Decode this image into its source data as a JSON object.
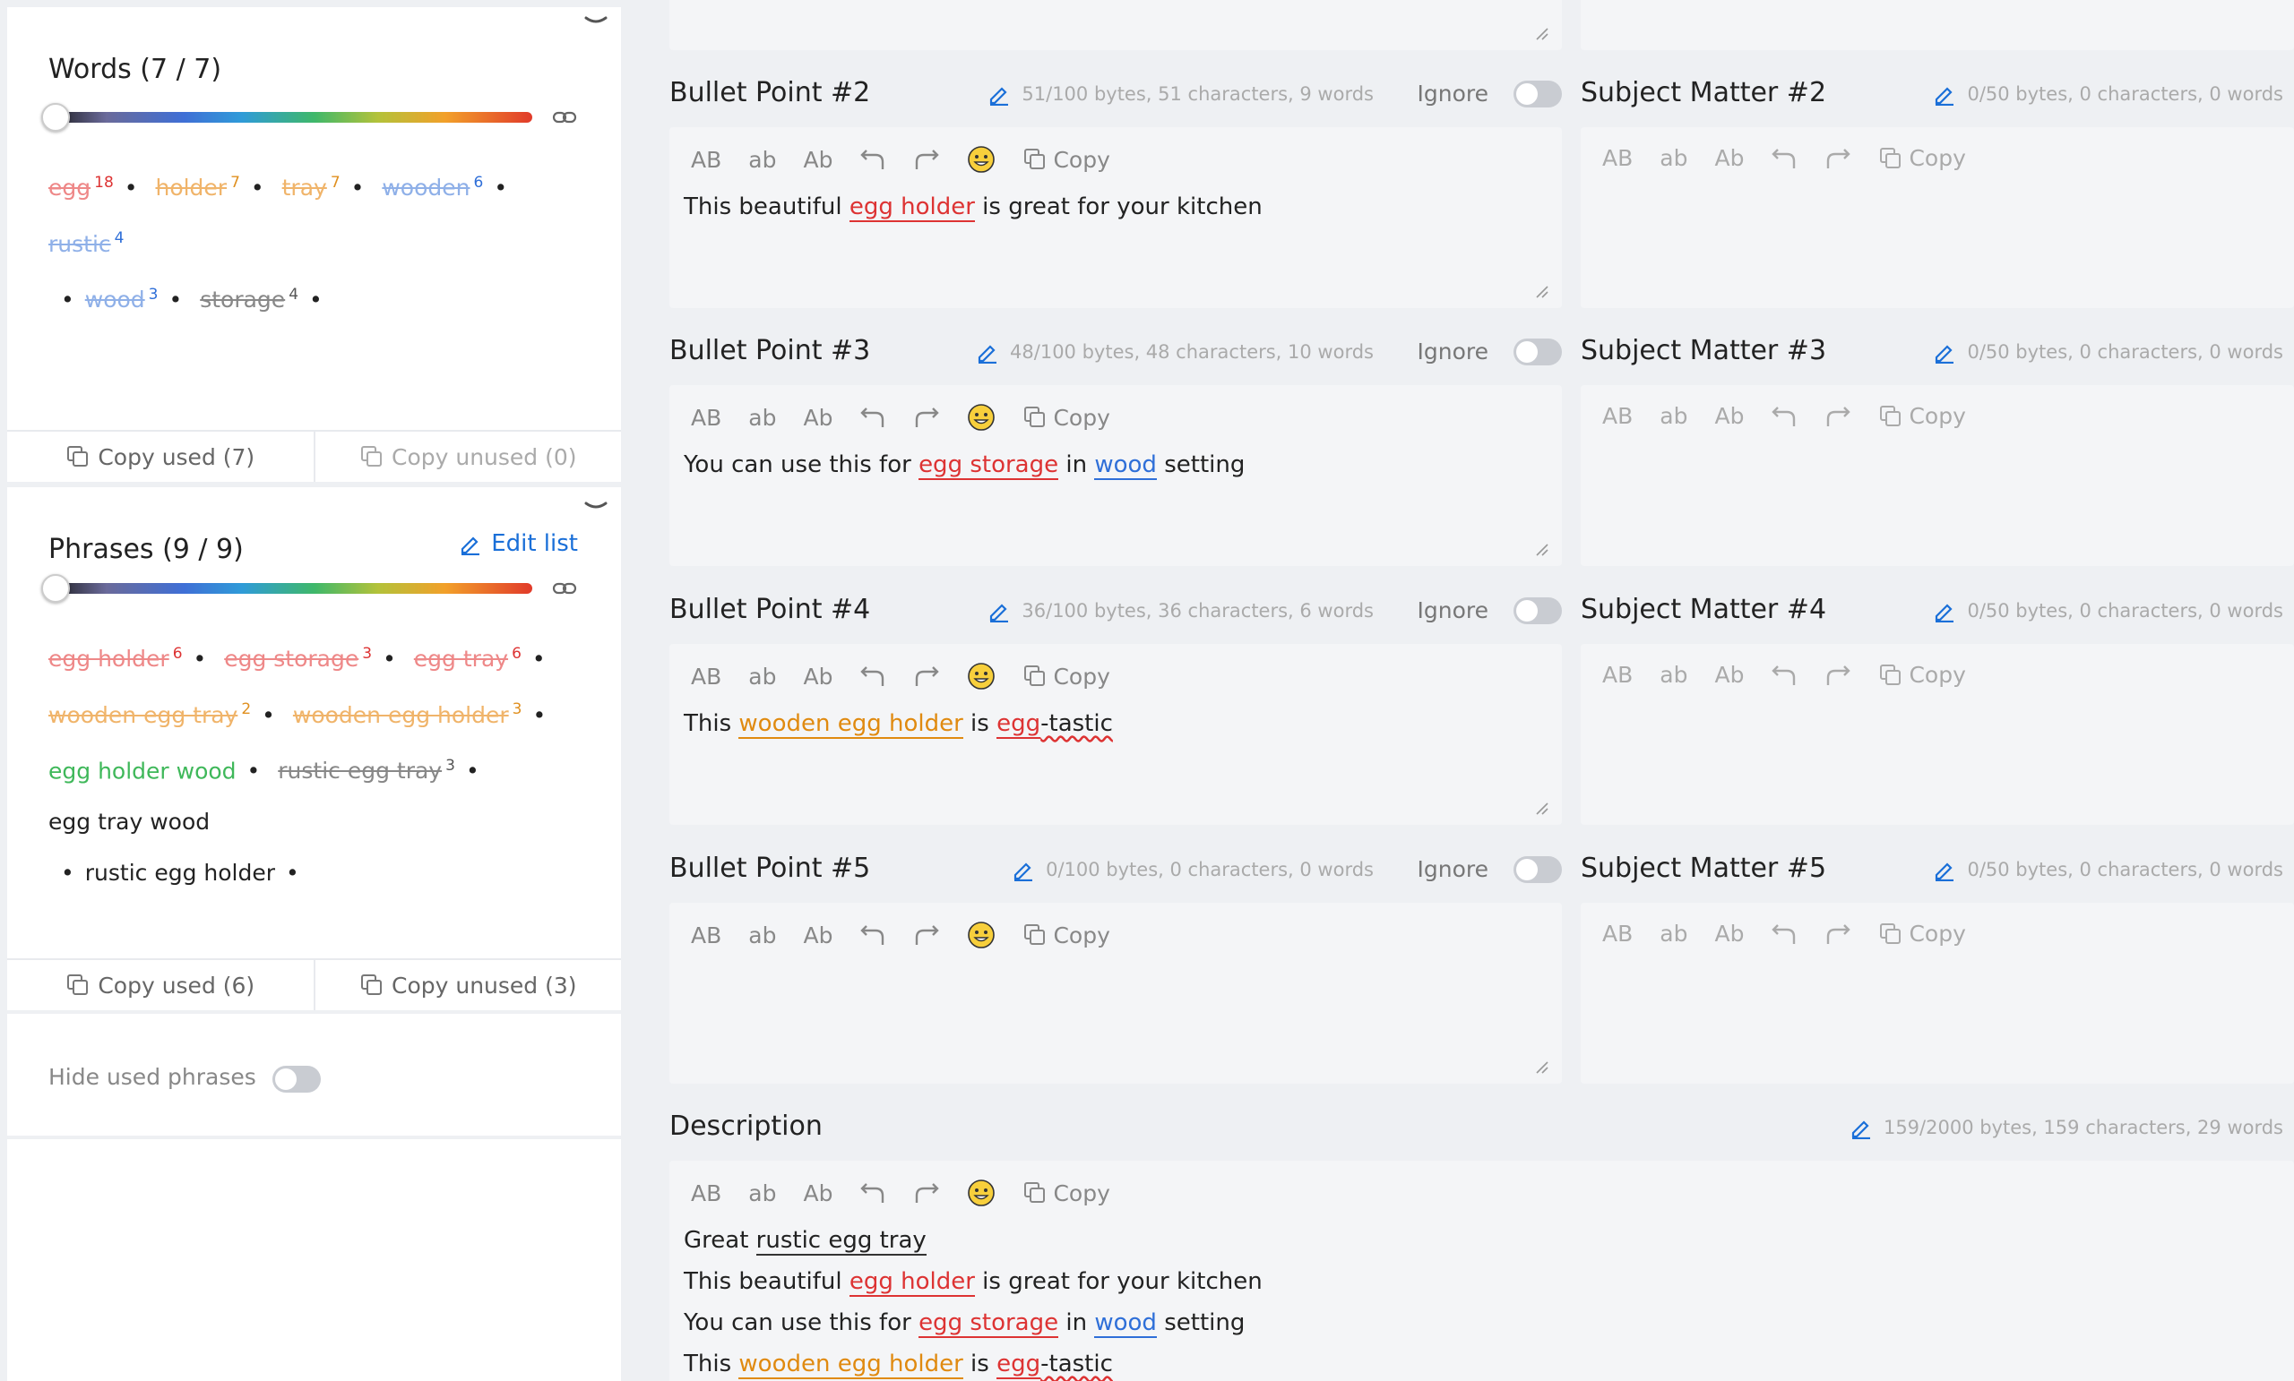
{
  "words": {
    "title": "Words (7 / 7)",
    "tags": [
      {
        "text": "egg",
        "count": "18",
        "color": "red"
      },
      {
        "text": "holder",
        "count": "7",
        "color": "org"
      },
      {
        "text": "tray",
        "count": "7",
        "color": "org"
      },
      {
        "text": "wooden",
        "count": "6",
        "color": "blue"
      },
      {
        "text": "rustic",
        "count": "4",
        "color": "blue"
      },
      {
        "text": "wood",
        "count": "3",
        "color": "blue"
      },
      {
        "text": "storage",
        "count": "4",
        "color": "gray"
      }
    ],
    "copy_used": "Copy used (7)",
    "copy_unused": "Copy unused (0)"
  },
  "phrases": {
    "title": "Phrases (9 / 9)",
    "edit_list": "Edit list",
    "tags": [
      {
        "text": "egg holder",
        "count": "6",
        "color": "red"
      },
      {
        "text": "egg storage",
        "count": "3",
        "color": "red"
      },
      {
        "text": "egg tray",
        "count": "6",
        "color": "red"
      },
      {
        "text": "wooden egg tray",
        "count": "2",
        "color": "org"
      },
      {
        "text": "wooden egg holder",
        "count": "3",
        "color": "org"
      },
      {
        "text": "egg holder wood",
        "count": "",
        "color": "green"
      },
      {
        "text": "rustic egg tray",
        "count": "3",
        "color": "gray"
      },
      {
        "text": "egg tray wood",
        "count": "",
        "color": "plain"
      },
      {
        "text": "rustic egg holder",
        "count": "",
        "color": "plain"
      }
    ],
    "copy_used": "Copy used (6)",
    "copy_unused": "Copy unused (3)"
  },
  "hide_used": {
    "label": "Hide used phrases"
  },
  "toolbar": {
    "upper": "AB",
    "lower": "ab",
    "title": "Ab",
    "copy": "Copy"
  },
  "ignore_label": "Ignore",
  "bullets": [
    {
      "title": "Bullet Point #2",
      "stats": "51/100 bytes, 51 characters, 9 words"
    },
    {
      "title": "Bullet Point #3",
      "stats": "48/100 bytes, 48 characters, 10 words"
    },
    {
      "title": "Bullet Point #4",
      "stats": "36/100 bytes, 36 characters, 6 words"
    },
    {
      "title": "Bullet Point #5",
      "stats": "0/100 bytes, 0 characters, 0 words"
    }
  ],
  "subjects": [
    {
      "title": "Subject Matter #2",
      "stats": "0/50 bytes, 0 characters, 0 words"
    },
    {
      "title": "Subject Matter #3",
      "stats": "0/50 bytes, 0 characters, 0 words"
    },
    {
      "title": "Subject Matter #4",
      "stats": "0/50 bytes, 0 characters, 0 words"
    },
    {
      "title": "Subject Matter #5",
      "stats": "0/50 bytes, 0 characters, 0 words"
    }
  ],
  "bullet_text": {
    "b2": [
      "This beautiful ",
      "egg holder",
      " is great for your kitchen"
    ],
    "b3": [
      "You can use this for ",
      "egg storage",
      " in ",
      "wood",
      " setting"
    ],
    "b4": [
      "This ",
      "wooden egg holder",
      " is ",
      "egg",
      "-tastic"
    ]
  },
  "description": {
    "title": "Description",
    "stats": "159/2000 bytes, 159 characters, 29 words",
    "l1": [
      "Great ",
      "rustic egg tray"
    ],
    "l2": [
      "This beautiful ",
      "egg holder",
      " is great for your kitchen"
    ],
    "l3": [
      "You can use this for ",
      "egg storage",
      " in ",
      "wood",
      " setting"
    ],
    "l4": [
      "This ",
      "wooden egg holder",
      " is ",
      "egg",
      "-tastic"
    ]
  },
  "colors": {
    "accent": "#1a6fd8",
    "red": "#d33333",
    "orange": "#e08a10",
    "blue": "#2f6fd8",
    "green": "#3fb85a"
  }
}
